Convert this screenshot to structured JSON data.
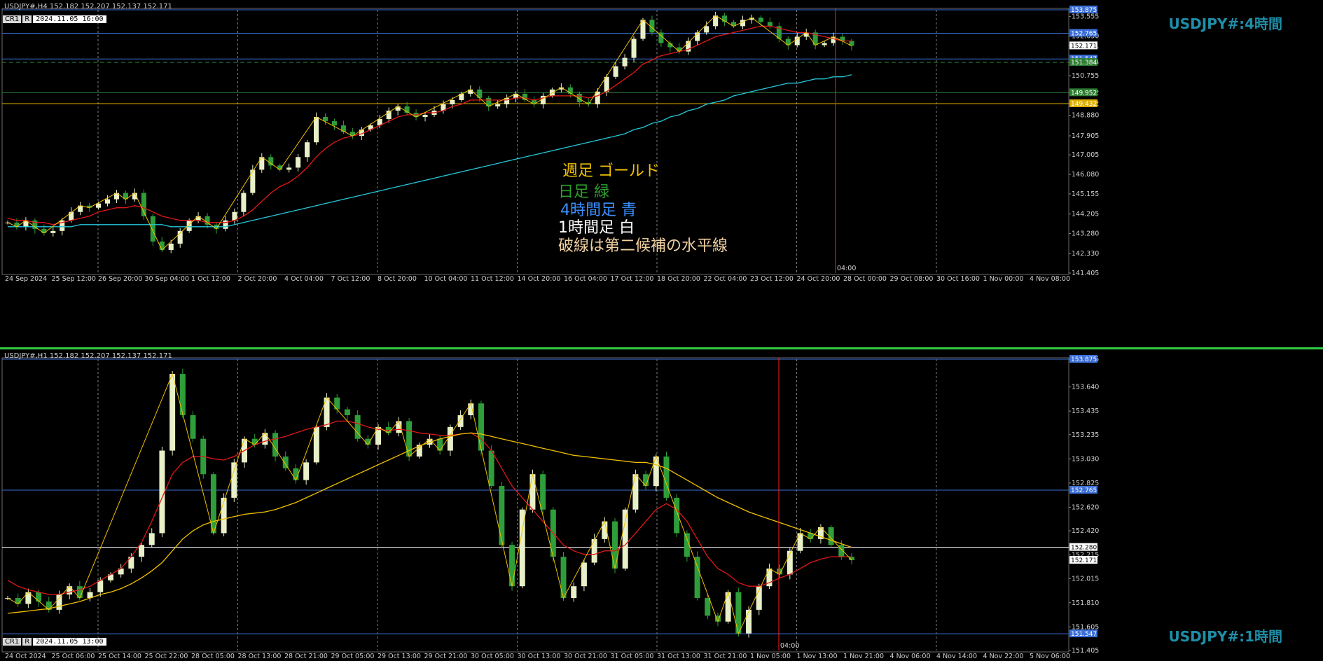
{
  "colors": {
    "sma_red": "#e01818",
    "sma_cyan": "#25c8d8",
    "zigzag": "#f0c000",
    "hline_blue": "#3b6fd8",
    "hline_green": "#2e7d32",
    "hline_yellow": "#e0b000",
    "bull": "#e8f0c8",
    "bear": "#2f9e3a",
    "vline": "#ff2020"
  },
  "top": {
    "header": "USDJPY#,H4  152.182 152.207 152.137 152.171",
    "badge_a": "CR1",
    "badge_b": "R",
    "badge_date": "2024.11.05 16:00",
    "symbol_label": "USDJPY#:4時間",
    "vline_label": "04:00",
    "legend": [
      {
        "text": "週足  ゴールド",
        "color": "#f0c000"
      },
      {
        "text": "日足  緑",
        "color": "#2e9e2e"
      },
      {
        "text": "4時間足  青",
        "color": "#3a8fff"
      },
      {
        "text": "1時間足  白",
        "color": "#ffffff"
      },
      {
        "text": "破線は第二候補の水平線",
        "color": "#f0d0a0"
      }
    ]
  },
  "bottom": {
    "header": "USDJPY#,H1  152.182 152.207 152.137 152.171",
    "badge_a": "CR1",
    "badge_b": "R",
    "badge_date": "2024.11.05 13:00",
    "symbol_label": "USDJPY#:1時間",
    "vline_label": "04:00"
  },
  "chart_data": [
    {
      "type": "candlestick",
      "title": "USDJPY#,H4",
      "ylim": [
        141.405,
        153.875
      ],
      "y_ticks": [
        "153.555",
        "152.630",
        "152.171",
        "151.384",
        "150.755",
        "149.952",
        "149.432",
        "148.880",
        "147.905",
        "147.005",
        "146.080",
        "145.155",
        "144.205",
        "143.280",
        "142.330",
        "141.405"
      ],
      "x_ticks": [
        "24 Sep 2024",
        "25 Sep 12:00",
        "26 Sep 20:00",
        "30 Sep 04:00",
        "1 Oct 12:00",
        "2 Oct 20:00",
        "4 Oct 04:00",
        "7 Oct 12:00",
        "8 Oct 20:00",
        "10 Oct 04:00",
        "11 Oct 12:00",
        "14 Oct 20:00",
        "16 Oct 04:00",
        "17 Oct 12:00",
        "18 Oct 20:00",
        "22 Oct 04:00",
        "23 Oct 12:00",
        "24 Oct 20:00",
        "28 Oct 00:00",
        "29 Oct 08:00",
        "30 Oct 16:00",
        "1 Nov 00:00",
        "4 Nov 08:00"
      ],
      "horizontal_lines": [
        {
          "price": 153.875,
          "label": "153.875",
          "color": "#3b6fd8",
          "style": "solid"
        },
        {
          "price": 152.765,
          "label": "152.765",
          "color": "#3b6fd8",
          "style": "solid"
        },
        {
          "price": 152.171,
          "label": "152.171",
          "color": "#ffffff",
          "style": "current"
        },
        {
          "price": 151.547,
          "label": "151.547",
          "color": "#3b6fd8",
          "style": "solid"
        },
        {
          "price": 151.384,
          "label": "151.384",
          "color": "#2e7d32",
          "style": "dashed"
        },
        {
          "price": 149.952,
          "label": "149.952",
          "color": "#2e7d32",
          "style": "solid"
        },
        {
          "price": 149.432,
          "label": "149.432",
          "color": "#e0b000",
          "style": "solid"
        }
      ],
      "series": [
        {
          "kind": "close",
          "values": [
            143.8,
            143.6,
            143.9,
            143.5,
            143.3,
            143.4,
            143.9,
            144.3,
            144.6,
            144.5,
            144.7,
            144.9,
            145.2,
            144.9,
            145.2,
            144.1,
            142.9,
            142.5,
            142.8,
            143.4,
            143.9,
            144.1,
            143.7,
            143.5,
            143.9,
            144.3,
            145.2,
            146.3,
            146.9,
            146.5,
            146.3,
            146.4,
            146.9,
            147.6,
            148.8,
            148.6,
            148.4,
            148.1,
            147.9,
            148.2,
            148.4,
            148.7,
            149.1,
            149.3,
            149.0,
            148.8,
            148.9,
            149.1,
            149.4,
            149.6,
            149.9,
            150.1,
            149.7,
            149.3,
            149.4,
            149.7,
            149.9,
            149.6,
            149.4,
            149.8,
            150.1,
            150.2,
            149.9,
            149.5,
            149.4,
            150.0,
            150.7,
            151.2,
            151.6,
            152.5,
            153.4,
            152.8,
            152.3,
            152.1,
            151.9,
            152.4,
            152.8,
            153.1,
            153.6,
            153.3,
            153.1,
            153.4,
            153.5,
            153.3,
            153.1,
            152.5,
            152.2,
            152.6,
            152.8,
            152.2,
            152.3,
            152.6,
            152.4,
            152.171
          ]
        },
        {
          "kind": "sma_red",
          "values": [
            144.0,
            143.9,
            143.9,
            143.8,
            143.8,
            143.7,
            143.8,
            143.9,
            144.0,
            144.1,
            144.3,
            144.4,
            144.5,
            144.5,
            144.6,
            144.5,
            144.3,
            144.1,
            144.0,
            143.9,
            143.9,
            143.9,
            143.8,
            143.8,
            143.8,
            143.9,
            144.1,
            144.4,
            144.8,
            145.2,
            145.5,
            145.7,
            146.0,
            146.4,
            146.9,
            147.3,
            147.6,
            147.8,
            147.9,
            148.0,
            148.2,
            148.4,
            148.6,
            148.8,
            148.9,
            148.9,
            149.0,
            149.0,
            149.1,
            149.3,
            149.4,
            149.6,
            149.6,
            149.6,
            149.6,
            149.6,
            149.7,
            149.7,
            149.6,
            149.7,
            149.8,
            149.8,
            149.8,
            149.8,
            149.7,
            149.8,
            150.0,
            150.3,
            150.6,
            150.9,
            151.3,
            151.5,
            151.7,
            151.8,
            151.9,
            152.0,
            152.2,
            152.4,
            152.6,
            152.7,
            152.8,
            152.9,
            153.0,
            153.1,
            153.1,
            153.0,
            152.9,
            152.8,
            152.8,
            152.7,
            152.6,
            152.5,
            152.4,
            152.4
          ]
        },
        {
          "kind": "sma_cyan",
          "values": [
            143.6,
            143.6,
            143.6,
            143.6,
            143.6,
            143.6,
            143.6,
            143.6,
            143.7,
            143.7,
            143.7,
            143.7,
            143.7,
            143.7,
            143.7,
            143.7,
            143.7,
            143.7,
            143.6,
            143.6,
            143.6,
            143.6,
            143.6,
            143.6,
            143.6,
            143.7,
            143.8,
            143.9,
            144.0,
            144.1,
            144.2,
            144.3,
            144.4,
            144.5,
            144.6,
            144.7,
            144.8,
            144.9,
            145.0,
            145.1,
            145.2,
            145.3,
            145.4,
            145.5,
            145.6,
            145.7,
            145.8,
            145.9,
            146.0,
            146.1,
            146.2,
            146.3,
            146.4,
            146.5,
            146.6,
            146.7,
            146.8,
            146.9,
            147.0,
            147.1,
            147.2,
            147.3,
            147.4,
            147.5,
            147.6,
            147.7,
            147.8,
            147.9,
            148.0,
            148.2,
            148.3,
            148.5,
            148.6,
            148.8,
            148.9,
            149.1,
            149.2,
            149.4,
            149.5,
            149.6,
            149.8,
            149.9,
            150.0,
            150.1,
            150.2,
            150.3,
            150.4,
            150.4,
            150.5,
            150.6,
            150.6,
            150.7,
            150.7,
            150.8
          ]
        }
      ]
    },
    {
      "type": "candlestick",
      "title": "USDJPY#,H1",
      "ylim": [
        151.405,
        153.875
      ],
      "y_ticks": [
        "153.875",
        "153.640",
        "153.435",
        "153.235",
        "153.030",
        "152.825",
        "152.620",
        "152.420",
        "152.215",
        "152.015",
        "151.810",
        "151.605",
        "151.405"
      ],
      "x_ticks": [
        "24 Oct 2024",
        "25 Oct 06:00",
        "25 Oct 14:00",
        "25 Oct 22:00",
        "28 Oct 05:00",
        "28 Oct 13:00",
        "28 Oct 21:00",
        "29 Oct 05:00",
        "29 Oct 13:00",
        "29 Oct 21:00",
        "30 Oct 05:00",
        "30 Oct 13:00",
        "30 Oct 21:00",
        "31 Oct 05:00",
        "31 Oct 13:00",
        "31 Oct 21:00",
        "1 Nov 05:00",
        "1 Nov 13:00",
        "1 Nov 21:00",
        "4 Nov 06:00",
        "4 Nov 14:00",
        "4 Nov 22:00",
        "5 Nov 06:00"
      ],
      "horizontal_lines": [
        {
          "price": 153.875,
          "label": "153.875",
          "color": "#3b6fd8",
          "style": "solid"
        },
        {
          "price": 152.765,
          "label": "152.765",
          "color": "#3b6fd8",
          "style": "solid"
        },
        {
          "price": 152.28,
          "label": "152.280",
          "color": "#ffffff",
          "style": "solid"
        },
        {
          "price": 152.171,
          "label": "152.171",
          "color": "#ffffff",
          "style": "current"
        },
        {
          "price": 151.547,
          "label": "151.547",
          "color": "#3b6fd8",
          "style": "solid"
        }
      ],
      "series": [
        {
          "kind": "close",
          "values": [
            151.85,
            151.8,
            151.9,
            151.82,
            151.75,
            151.88,
            151.95,
            151.85,
            151.9,
            152.0,
            152.05,
            152.1,
            152.2,
            152.3,
            152.4,
            153.1,
            153.75,
            153.4,
            153.2,
            152.9,
            152.4,
            152.7,
            153.0,
            153.2,
            153.15,
            153.25,
            153.05,
            152.95,
            152.85,
            153.0,
            153.3,
            153.55,
            153.45,
            153.4,
            153.2,
            153.15,
            153.3,
            153.25,
            153.35,
            153.05,
            153.15,
            153.2,
            153.1,
            153.3,
            153.4,
            153.5,
            153.1,
            152.8,
            152.3,
            151.95,
            152.6,
            152.9,
            152.6,
            152.2,
            151.85,
            151.95,
            152.15,
            152.35,
            152.5,
            152.1,
            152.6,
            152.9,
            152.8,
            153.05,
            152.7,
            152.4,
            152.2,
            151.85,
            151.7,
            151.65,
            151.9,
            151.55,
            151.75,
            151.95,
            152.1,
            152.05,
            152.25,
            152.4,
            152.35,
            152.45,
            152.3,
            152.2,
            152.171
          ]
        },
        {
          "kind": "sma_red",
          "values": [
            152.0,
            151.95,
            151.92,
            151.9,
            151.88,
            151.88,
            151.9,
            151.92,
            151.95,
            152.0,
            152.05,
            152.1,
            152.2,
            152.32,
            152.5,
            152.7,
            152.9,
            153.0,
            153.05,
            153.05,
            153.03,
            153.02,
            153.05,
            153.1,
            153.15,
            153.18,
            153.2,
            153.22,
            153.25,
            153.28,
            153.3,
            153.32,
            153.35,
            153.35,
            153.33,
            153.3,
            153.28,
            153.27,
            153.28,
            153.27,
            153.25,
            153.24,
            153.23,
            153.23,
            153.24,
            153.25,
            153.2,
            153.1,
            152.95,
            152.8,
            152.7,
            152.6,
            152.5,
            152.4,
            152.3,
            152.25,
            152.22,
            152.22,
            152.25,
            152.25,
            152.3,
            152.4,
            152.5,
            152.6,
            152.65,
            152.6,
            152.5,
            152.35,
            152.2,
            152.1,
            152.05,
            151.98,
            151.95,
            151.95,
            151.98,
            152.02,
            152.05,
            152.1,
            152.15,
            152.18,
            152.2,
            152.2,
            152.2
          ]
        },
        {
          "kind": "sma_yellow",
          "values": [
            151.72,
            151.73,
            151.74,
            151.75,
            151.76,
            151.78,
            151.8,
            151.82,
            151.85,
            151.88,
            151.9,
            151.93,
            151.97,
            152.02,
            152.08,
            152.15,
            152.25,
            152.35,
            152.42,
            152.47,
            152.5,
            152.52,
            152.54,
            152.56,
            152.57,
            152.58,
            152.6,
            152.63,
            152.66,
            152.7,
            152.74,
            152.78,
            152.82,
            152.86,
            152.9,
            152.94,
            152.98,
            153.02,
            153.06,
            153.1,
            153.14,
            153.17,
            153.2,
            153.22,
            153.24,
            153.25,
            153.24,
            153.22,
            153.2,
            153.18,
            153.16,
            153.14,
            153.12,
            153.1,
            153.08,
            153.06,
            153.05,
            153.04,
            153.03,
            153.02,
            153.01,
            153.0,
            153.0,
            152.98,
            152.95,
            152.9,
            152.85,
            152.8,
            152.75,
            152.7,
            152.66,
            152.62,
            152.58,
            152.55,
            152.52,
            152.49,
            152.46,
            152.43,
            152.4,
            152.37,
            152.34,
            152.31,
            152.28
          ]
        }
      ]
    }
  ]
}
